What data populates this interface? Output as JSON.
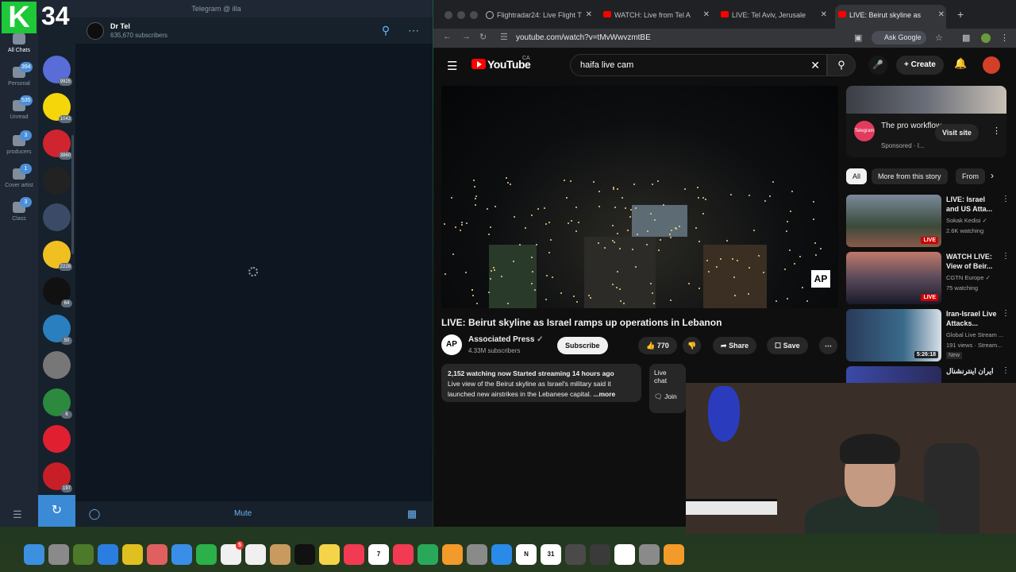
{
  "overlay": {
    "k_label": "K",
    "number": "34"
  },
  "telegram": {
    "window_title": "Telegram @ illa",
    "folders": [
      {
        "label": "All Chats",
        "badge": ""
      },
      {
        "label": "Personal",
        "badge": "394"
      },
      {
        "label": "Unread",
        "badge": "535"
      },
      {
        "label": "producers",
        "badge": "3"
      },
      {
        "label": "Cover artist",
        "badge": "1"
      },
      {
        "label": "Class",
        "badge": "3"
      }
    ],
    "chats": [
      {
        "color": "#5a6cd8",
        "count": "9925"
      },
      {
        "color": "#f5d60a",
        "count": "1043"
      },
      {
        "color": "#d02430",
        "count": "3860"
      },
      {
        "color": "#222222",
        "count": ""
      },
      {
        "color": "#3b4a66",
        "count": ""
      },
      {
        "color": "#f0c020",
        "count": "2228"
      },
      {
        "color": "#111111",
        "count": "64"
      },
      {
        "color": "#2a7fbf",
        "count": "50"
      },
      {
        "color": "#777777",
        "count": ""
      },
      {
        "color": "#2b8a3e",
        "count": "6"
      },
      {
        "color": "#e02030",
        "count": ""
      },
      {
        "color": "#c81e28",
        "count": "197"
      }
    ],
    "channel": {
      "name": "Dr Tel",
      "subscribers": "635,670 subscribers"
    },
    "bottom": {
      "mute_label": "Mute"
    }
  },
  "chrome": {
    "tabs": [
      {
        "title": "Flightradar24: Live Flight T",
        "active": false
      },
      {
        "title": "WATCH: Live from Tel A",
        "active": false
      },
      {
        "title": "LIVE: Tel Aviv, Jerusale",
        "active": false
      },
      {
        "title": "LIVE: Beirut skyline as",
        "active": true
      }
    ],
    "url": "youtube.com/watch?v=tMvWwvzmtBE",
    "ask_google": "Ask Google"
  },
  "youtube": {
    "brand": "YouTube",
    "region": "CA",
    "search_query": "haifa live cam",
    "create_label": "Create",
    "video": {
      "title": "LIVE: Beirut skyline as Israel ramps up operations in Lebanon",
      "watermark": "AP",
      "channel_avatar": "AP",
      "channel": "Associated Press",
      "subscribers": "4.33M subscribers",
      "subscribe": "Subscribe",
      "likes": "770",
      "share": "Share",
      "save": "Save",
      "desc_stats": "2,152 watching now  Started streaming 14 hours ago",
      "desc_text": "Live view of the Beirut skyline as Israel's military said it launched new airstrikes in the Lebanese capital.",
      "desc_more": "...more",
      "live_chat": "Live chat",
      "join_text": "Join"
    },
    "sponsor": {
      "title": "The pro workflow...",
      "sponsored": "Sponsored · I...",
      "avatar_text": "Telegram",
      "visit": "Visit site"
    },
    "chips": [
      "All",
      "More from this story",
      "From"
    ],
    "recommendations": [
      {
        "title": "LIVE: Israel and US Atta...",
        "channel": "Sokak Kedisi ✓",
        "meta": "2.6K watching",
        "badge": "LIVE",
        "new": ""
      },
      {
        "title": "WATCH LIVE: View of Beir...",
        "channel": "CGTN Europe ✓",
        "meta": "75 watching",
        "badge": "LIVE",
        "new": ""
      },
      {
        "title": "Iran-Israel Live Attacks...",
        "channel": "Global Live Stream ...",
        "meta": "191 views · Stream...",
        "badge": "5:26:18",
        "new": "New"
      },
      {
        "title": "ایران اینترنشنال",
        "channel": "",
        "meta": "",
        "badge": "",
        "new": ""
      }
    ]
  },
  "dock": {
    "apps": [
      {
        "name": "Finder",
        "color": "#3d8fe0"
      },
      {
        "name": "Launchpad",
        "color": "#8a8a8a"
      },
      {
        "name": "Script Editor",
        "color": "#4d7a2a"
      },
      {
        "name": "Safari",
        "color": "#2b7de0"
      },
      {
        "name": "Chrome",
        "color": "#e0c020"
      },
      {
        "name": "Photos",
        "color": "#e06060"
      },
      {
        "name": "Mail",
        "color": "#3a8ee8"
      },
      {
        "name": "FaceTime",
        "color": "#2bb04a"
      },
      {
        "name": "Reminders",
        "color": "#f0f0f0",
        "badge": "5"
      },
      {
        "name": "Freeform",
        "color": "#f0f0f0"
      },
      {
        "name": "Contacts",
        "color": "#c89a60"
      },
      {
        "name": "TV",
        "color": "#111111",
        "label": "tv"
      },
      {
        "name": "Notes",
        "color": "#f5d44a"
      },
      {
        "name": "Music",
        "color": "#f23a52"
      },
      {
        "name": "Calendar",
        "color": "#ffffff",
        "label": "7"
      },
      {
        "name": "News",
        "color": "#f23a52"
      },
      {
        "name": "Numbers",
        "color": "#2aa85a"
      },
      {
        "name": "Pages",
        "color": "#f29a2a"
      },
      {
        "name": "System Settings",
        "color": "#8a8a8a"
      },
      {
        "name": "App Store",
        "color": "#2a8ae8"
      },
      {
        "name": "Notion",
        "color": "#ffffff",
        "label": "N"
      },
      {
        "name": "Google Calendar",
        "color": "#ffffff",
        "label": "31"
      },
      {
        "name": "Instruments",
        "color": "#4a4a4a"
      },
      {
        "name": "Logic Pro",
        "color": "#3a3a3a"
      },
      {
        "name": "Unity",
        "color": "#ffffff"
      },
      {
        "name": "Disk Utility",
        "color": "#8a8a8a"
      },
      {
        "name": "GarageBand",
        "color": "#f29a2a"
      }
    ]
  }
}
